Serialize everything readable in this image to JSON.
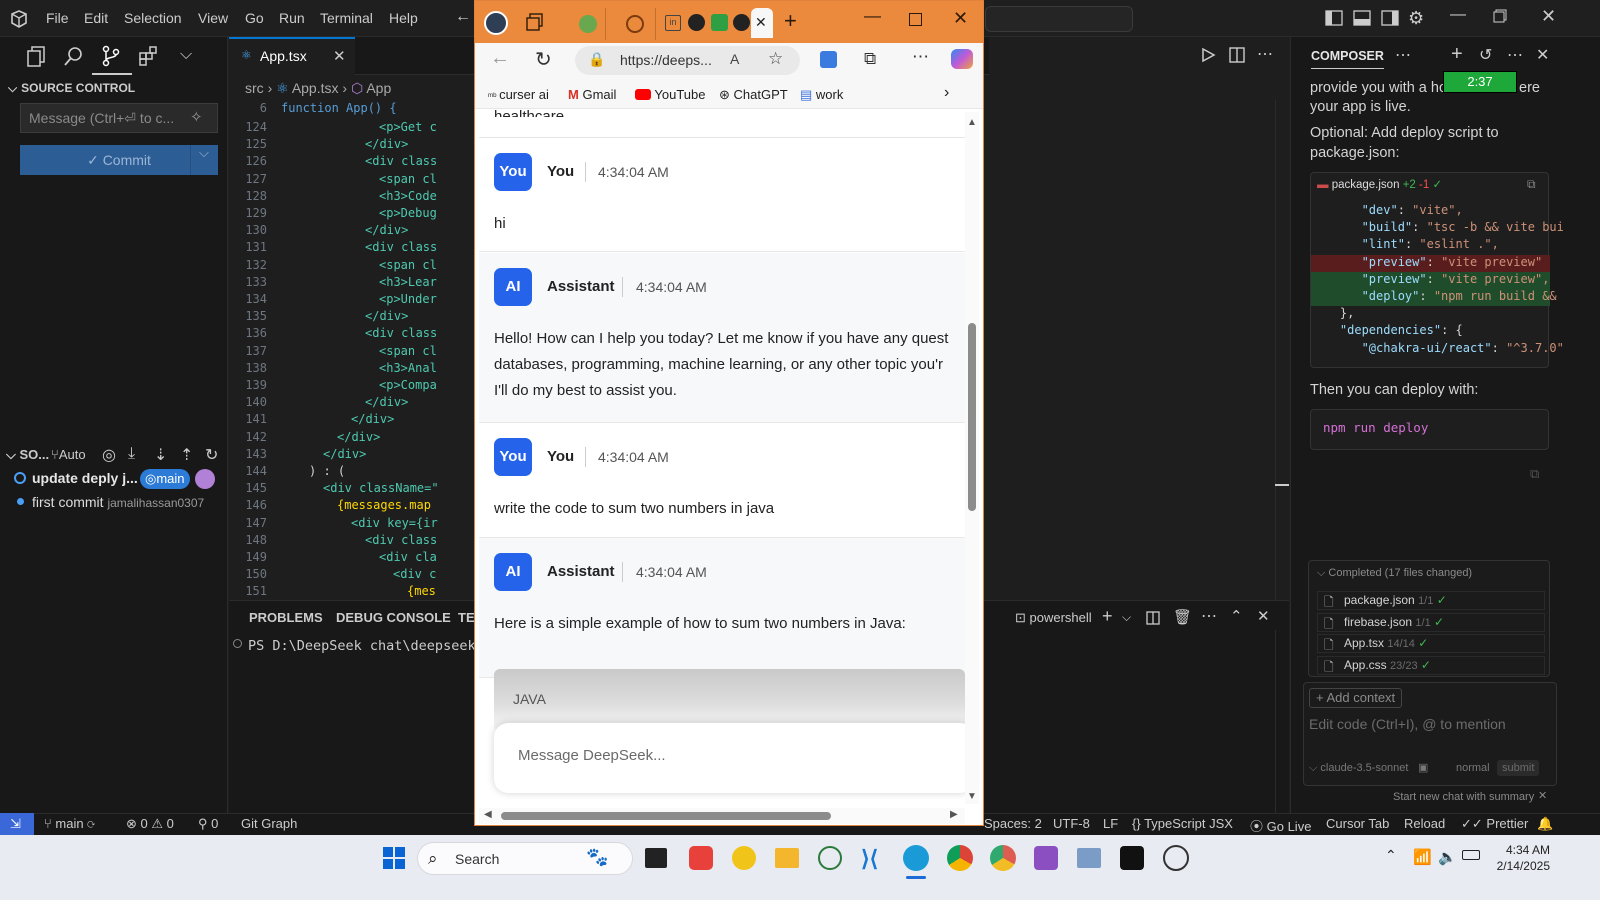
{
  "menubar": {
    "items": [
      "File",
      "Edit",
      "Selection",
      "View",
      "Go",
      "Run",
      "Terminal",
      "Help"
    ]
  },
  "sidebar": {
    "title": "SOURCE CONTROL",
    "message_placeholder": "Message (Ctrl+⏎ to c...",
    "commit_label": "✓ Commit",
    "graph_header": "SO...",
    "graph_auto": "Auto",
    "commits": [
      {
        "message": "update deply j...",
        "branch": "main"
      },
      {
        "message": "first commit",
        "author": "jamalihassan0307"
      }
    ]
  },
  "editor": {
    "tab_label": "App.tsx",
    "breadcrumb": [
      "src",
      "App.tsx",
      "App"
    ],
    "sticky_line": {
      "num": "6",
      "text": "function App() {"
    },
    "lines": [
      {
        "num": "124",
        "indent": 9,
        "text": "<p>Get c"
      },
      {
        "num": "125",
        "indent": 8,
        "text": "</div>"
      },
      {
        "num": "126",
        "indent": 8,
        "text": "<div class"
      },
      {
        "num": "127",
        "indent": 9,
        "text": "<span cl"
      },
      {
        "num": "128",
        "indent": 9,
        "text": "<h3>Code"
      },
      {
        "num": "129",
        "indent": 9,
        "text": "<p>Debug"
      },
      {
        "num": "130",
        "indent": 8,
        "text": "</div>"
      },
      {
        "num": "131",
        "indent": 8,
        "text": "<div class"
      },
      {
        "num": "132",
        "indent": 9,
        "text": "<span cl"
      },
      {
        "num": "133",
        "indent": 9,
        "text": "<h3>Lear"
      },
      {
        "num": "134",
        "indent": 9,
        "text": "<p>Under"
      },
      {
        "num": "135",
        "indent": 8,
        "text": "</div>"
      },
      {
        "num": "136",
        "indent": 8,
        "text": "<div class"
      },
      {
        "num": "137",
        "indent": 9,
        "text": "<span cl"
      },
      {
        "num": "138",
        "indent": 9,
        "text": "<h3>Anal"
      },
      {
        "num": "139",
        "indent": 9,
        "text": "<p>Compa"
      },
      {
        "num": "140",
        "indent": 8,
        "text": "</div>"
      },
      {
        "num": "141",
        "indent": 7,
        "text": "</div>"
      },
      {
        "num": "142",
        "indent": 6,
        "text": "</div>"
      },
      {
        "num": "143",
        "indent": 5,
        "text": "</div>"
      },
      {
        "num": "144",
        "indent": 4,
        "text": ") : ("
      },
      {
        "num": "145",
        "indent": 5,
        "text": "<div className=\""
      },
      {
        "num": "146",
        "indent": 6,
        "text": "{messages.map"
      },
      {
        "num": "147",
        "indent": 7,
        "text": "<div key={ir"
      },
      {
        "num": "148",
        "indent": 8,
        "text": "<div class"
      },
      {
        "num": "149",
        "indent": 9,
        "text": "<div cla"
      },
      {
        "num": "150",
        "indent": 10,
        "text": "<div c"
      },
      {
        "num": "151",
        "indent": 11,
        "text": "{mes"
      }
    ]
  },
  "panel": {
    "tabs": [
      "PROBLEMS",
      "DEBUG CONSOLE",
      "TE"
    ],
    "terminal_line": "PS D:\\DeepSeek chat\\deepseek-",
    "shell": "powershell"
  },
  "composer": {
    "title": "COMPOSER",
    "timer": "2:37",
    "text_top_1": "provide you with a ho",
    "text_top_1b": "ere",
    "text_top_2": "your app is live.",
    "text_optional": "Optional: Add deploy script to package.json:",
    "file_name": "package.json",
    "file_added": "+2",
    "file_removed": "-1",
    "code_lines": [
      {
        "key": "\"dev\"",
        "val": "\"vite\","
      },
      {
        "key": "\"build\"",
        "val": "\"tsc -b && vite bui"
      },
      {
        "key": "\"lint\"",
        "val": "\"eslint .\","
      },
      {
        "key": "\"preview\"",
        "val": "\"vite preview\""
      },
      {
        "key": "\"preview\"",
        "val": "\"vite preview\","
      },
      {
        "key": "\"deploy\"",
        "val": "\"npm run build &&"
      },
      {
        "key": "},",
        "val": ""
      },
      {
        "key": "\"dependencies\"",
        "val": "{"
      },
      {
        "key": "\"@chakra-ui/react\"",
        "val": "\"^3.7.0\""
      }
    ],
    "text_then": "Then you can deploy with:",
    "deploy_cmd": "npm run deploy",
    "completed_label": "Completed (17 files changed)",
    "files": [
      {
        "name": "package.json",
        "meta": "1/1"
      },
      {
        "name": "firebase.json",
        "meta": "1/1"
      },
      {
        "name": "App.tsx",
        "meta": "14/14"
      },
      {
        "name": "App.css",
        "meta": "23/23"
      }
    ],
    "add_context": "Add context",
    "input_placeholder": "Edit code (Ctrl+I), @ to mention",
    "model": "claude-3.5-sonnet",
    "mode": "normal",
    "submit": "submit",
    "new_chat": "Start new chat with summary"
  },
  "browser": {
    "url": "https://deeps...",
    "bookmarks": [
      "curser ai",
      "Gmail",
      "YouTube",
      "ChatGPT",
      "work"
    ],
    "cut_text": "healthcare.",
    "messages": [
      {
        "avatar": "You",
        "sender": "You",
        "time": "4:34:04 AM",
        "lines": [
          "hi"
        ]
      },
      {
        "avatar": "AI",
        "sender": "Assistant",
        "time": "4:34:04 AM",
        "lines": [
          "Hello! How can I help you today? Let me know if you have any quest",
          "databases, programming, machine learning, or any other topic you'r",
          "I'll do my best to assist you."
        ]
      },
      {
        "avatar": "You",
        "sender": "You",
        "time": "4:34:04 AM",
        "lines": [
          "write the code to sum two numbers in java"
        ]
      },
      {
        "avatar": "AI",
        "sender": "Assistant",
        "time": "4:34:04 AM",
        "lines": [
          "Here is a simple example of how to sum two numbers in Java:"
        ]
      }
    ],
    "code_lang": "JAVA",
    "input_placeholder": "Message DeepSeek..."
  },
  "statusbar": {
    "branch": "main",
    "errors": "0",
    "warnings": "0",
    "ports": "0",
    "git_graph": "Git Graph",
    "spaces": "Spaces: 2",
    "encoding": "UTF-8",
    "eol": "LF",
    "language": "TypeScript JSX",
    "go_live": "Go Live",
    "cursor_tab": "Cursor Tab",
    "reload": "Reload",
    "prettier": "Prettier"
  },
  "taskbar": {
    "search": "Search",
    "time": "4:34 AM",
    "date": "2/14/2025"
  },
  "colors": {
    "accent": "#0078d4",
    "browser_tabstrip": "#eb8a3c",
    "avatar": "#2563eb",
    "timer": "#1ea83a"
  }
}
